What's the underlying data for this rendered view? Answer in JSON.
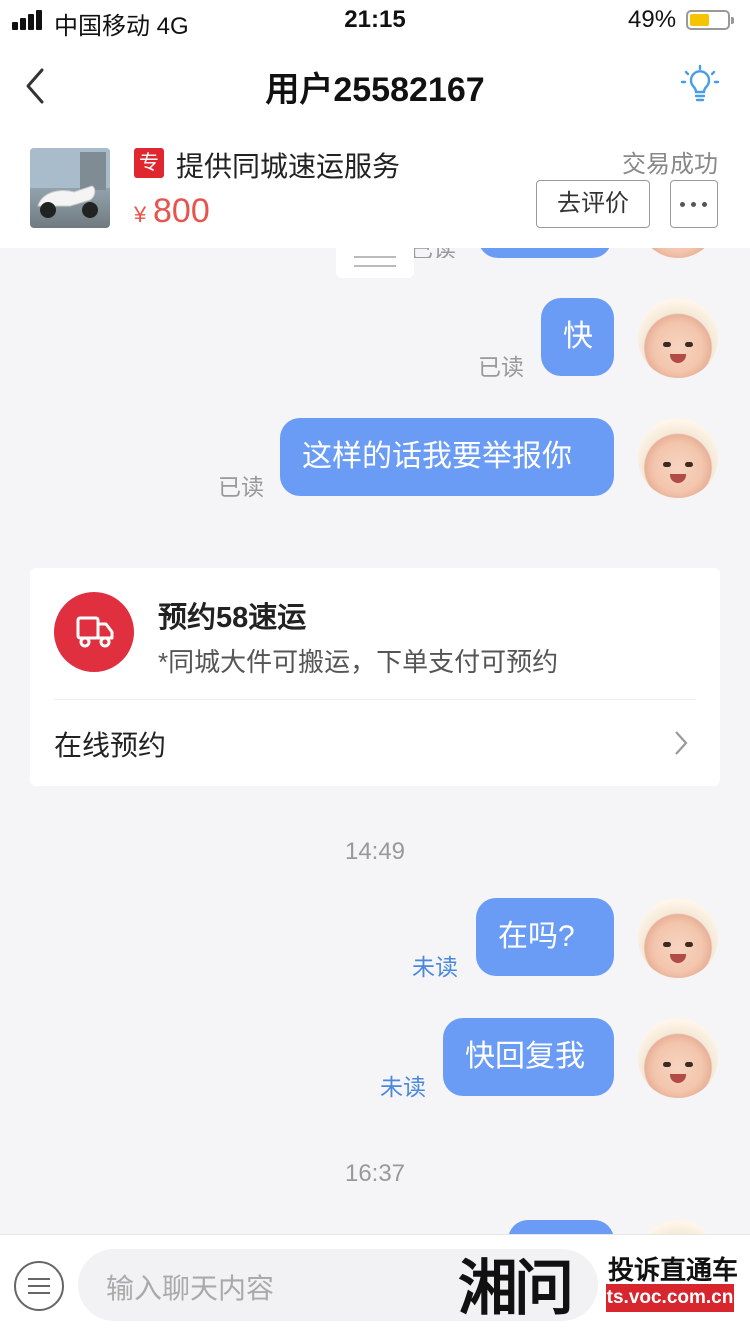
{
  "status_bar": {
    "carrier": "中国移动  4G",
    "time": "21:15",
    "battery": "49%"
  },
  "nav": {
    "title": "用户25582167"
  },
  "product": {
    "tag": "专",
    "title": "提供同城速运服务",
    "price_symbol": "¥",
    "price": "800",
    "status": "交易成功",
    "rate_label": "去评价"
  },
  "messages": [
    {
      "text": "快",
      "read_status": "已读"
    },
    {
      "text": "这样的话我要举报你",
      "read_status": "已读"
    },
    {
      "text": "在吗?",
      "read_status": "未读"
    },
    {
      "text": "快回复我",
      "read_status": "未读"
    }
  ],
  "partial_top_read": "已读",
  "card": {
    "title": "预约58速运",
    "subtitle": "*同城大件可搬运，下单支付可预约",
    "link": "在线预约"
  },
  "timestamps": [
    "14:49",
    "16:37"
  ],
  "input": {
    "placeholder": "输入聊天内容"
  },
  "watermark": {
    "logo": "湘问",
    "tagline": "投诉直通车",
    "url": "ts.voc.com.cn"
  },
  "colors": {
    "bubble": "#6b9cf5",
    "price": "#e8534b",
    "card_icon": "#e0303f",
    "unread": "#4a88dd"
  }
}
